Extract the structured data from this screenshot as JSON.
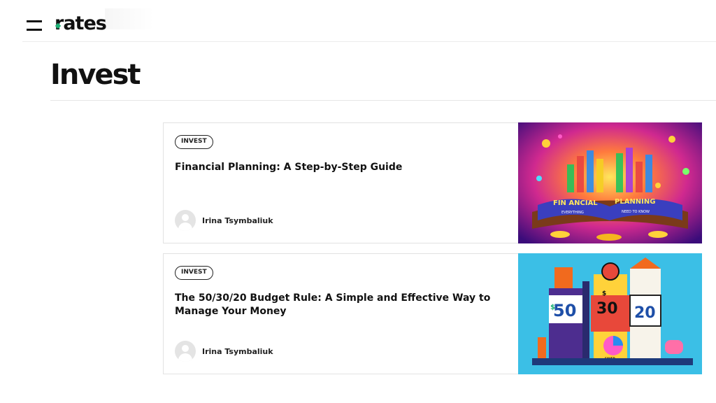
{
  "header": {
    "logo": "rates"
  },
  "page": {
    "title": "Invest"
  },
  "articles": [
    {
      "category": "INVEST",
      "title": "Financial Planning: A Step-by-Step Guide",
      "author": "Irina Tsymbaliuk",
      "image_text_1": "FIN ANCIAL",
      "image_text_2": "PLANNING",
      "image_text_3": "EVERYTHING",
      "image_text_4": "NEED TO KNOW"
    },
    {
      "category": "INVEST",
      "title": "The 50/30/20 Budget Rule: A Simple and Effective Way to Manage Your Money",
      "author": "Irina Tsymbaliuk",
      "image_num_1": "50",
      "image_num_2": "30",
      "image_num_3": "20",
      "image_dollar_1": "$",
      "image_dollar_2": "$",
      "image_caption": "SAVED"
    }
  ],
  "colors": {
    "accent": "#1eb377",
    "text": "#111111",
    "border": "#e2e2e2",
    "thumb2_bg": "#3bbfe6"
  }
}
